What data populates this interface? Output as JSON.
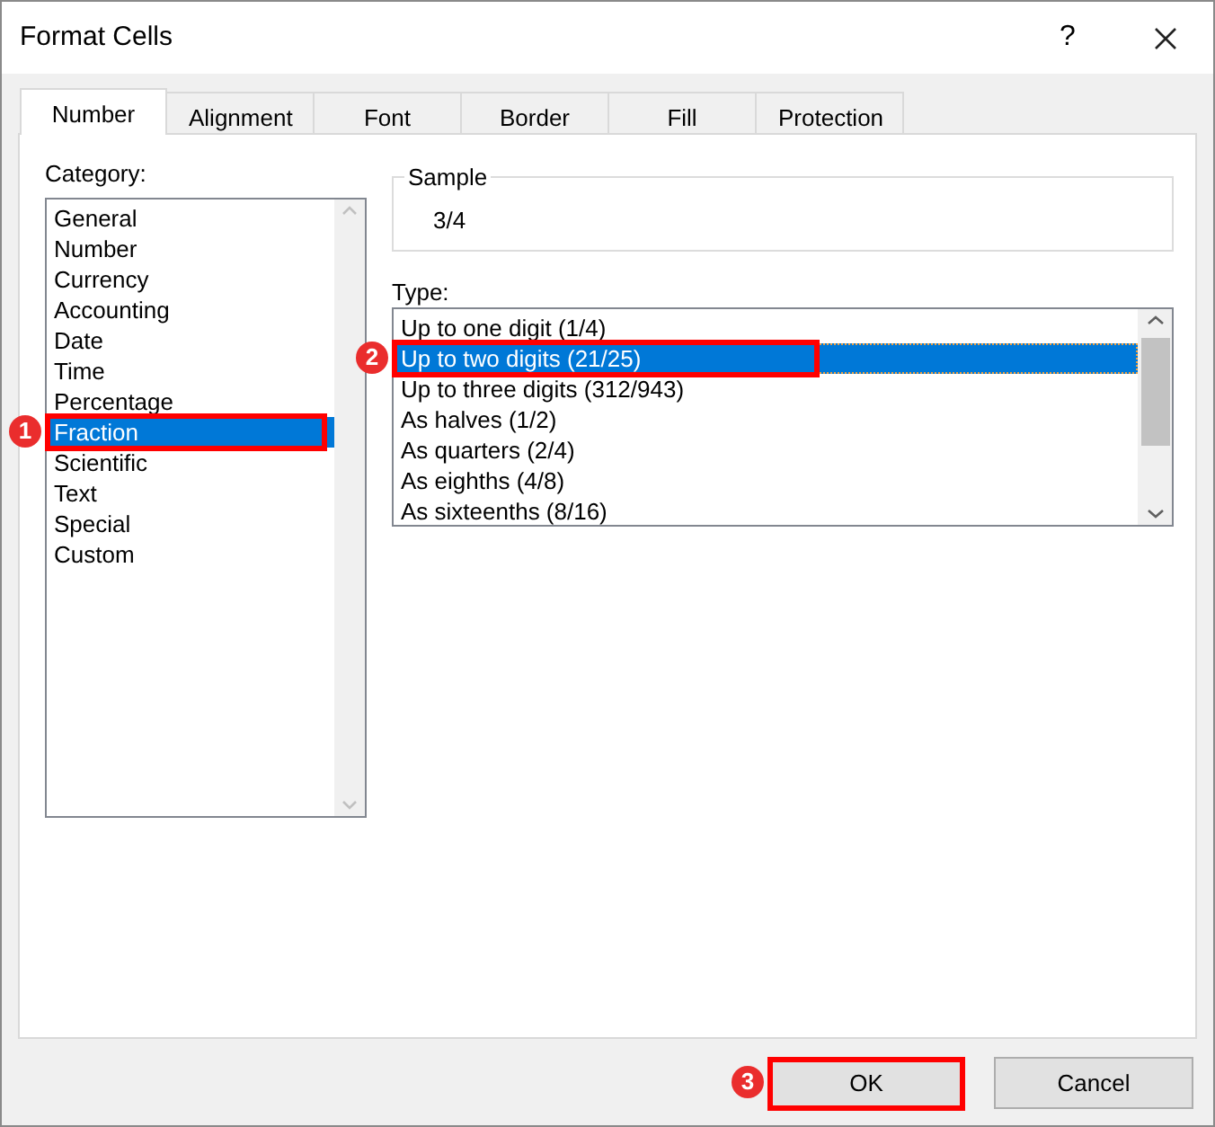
{
  "window": {
    "title": "Format Cells",
    "help": "?"
  },
  "tabs": [
    {
      "label": "Number",
      "selected": true
    },
    {
      "label": "Alignment",
      "selected": false
    },
    {
      "label": "Font",
      "selected": false
    },
    {
      "label": "Border",
      "selected": false
    },
    {
      "label": "Fill",
      "selected": false
    },
    {
      "label": "Protection",
      "selected": false
    }
  ],
  "category": {
    "label": "Category:",
    "items": [
      {
        "label": "General",
        "selected": false
      },
      {
        "label": "Number",
        "selected": false
      },
      {
        "label": "Currency",
        "selected": false
      },
      {
        "label": "Accounting",
        "selected": false
      },
      {
        "label": "Date",
        "selected": false
      },
      {
        "label": "Time",
        "selected": false
      },
      {
        "label": "Percentage",
        "selected": false
      },
      {
        "label": "Fraction",
        "selected": true,
        "callout": "1"
      },
      {
        "label": "Scientific",
        "selected": false
      },
      {
        "label": "Text",
        "selected": false
      },
      {
        "label": "Special",
        "selected": false
      },
      {
        "label": "Custom",
        "selected": false
      }
    ]
  },
  "sample": {
    "label": "Sample",
    "value": "3/4"
  },
  "type": {
    "label": "Type:",
    "items": [
      {
        "label": "Up to one digit (1/4)",
        "selected": false
      },
      {
        "label": "Up to two digits (21/25)",
        "selected": true,
        "callout": "2"
      },
      {
        "label": "Up to three digits (312/943)",
        "selected": false
      },
      {
        "label": "As halves (1/2)",
        "selected": false
      },
      {
        "label": "As quarters (2/4)",
        "selected": false
      },
      {
        "label": "As eighths (4/8)",
        "selected": false
      },
      {
        "label": "As sixteenths (8/16)",
        "selected": false
      }
    ]
  },
  "buttons": [
    {
      "label": "OK",
      "callout": "3"
    },
    {
      "label": "Cancel"
    }
  ]
}
